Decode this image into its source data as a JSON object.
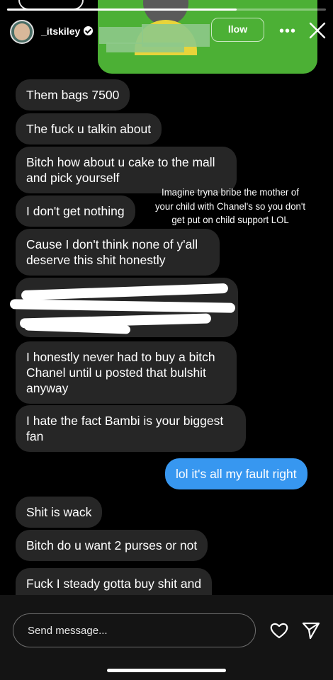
{
  "story": {
    "progress": 0.72,
    "username": "_itskiley",
    "follow_label": "llow",
    "more_label": "•••",
    "caption": "Imagine tryna bribe the mother of your child with Chanel's so you don't get put on child support LOL"
  },
  "messages": [
    {
      "text": "Them bags 7500",
      "sender": "them"
    },
    {
      "text": "The fuck u talkin about",
      "sender": "them"
    },
    {
      "text": "Bitch how about u cake to the mall and pick yourself",
      "sender": "them"
    },
    {
      "text": "I don't get nothing",
      "sender": "them"
    },
    {
      "text": "Cause I don't think none of y'all deserve this shit honestly",
      "sender": "them"
    },
    {
      "text": "",
      "sender": "them",
      "redacted": true
    },
    {
      "text": "I honestly never had to buy a bitch Chanel until u posted that bulshit anyway",
      "sender": "them"
    },
    {
      "text": "I hate the fact Bambi is your biggest fan",
      "sender": "them"
    },
    {
      "text": "lol it's all my fault right",
      "sender": "me"
    },
    {
      "text": "Shit is wack",
      "sender": "them"
    },
    {
      "text": "Bitch do u want 2 purses or not",
      "sender": "them"
    },
    {
      "text": "Fuck I steady gotta buy shit and",
      "sender": "them"
    }
  ],
  "composer": {
    "placeholder": "Send message..."
  },
  "colors": {
    "received_bubble": "#262626",
    "sent_bubble": "#3797f0",
    "story_background": "#4cb035"
  },
  "icons": [
    "verified-icon",
    "more-icon",
    "close-icon",
    "heart-icon",
    "send-icon"
  ]
}
